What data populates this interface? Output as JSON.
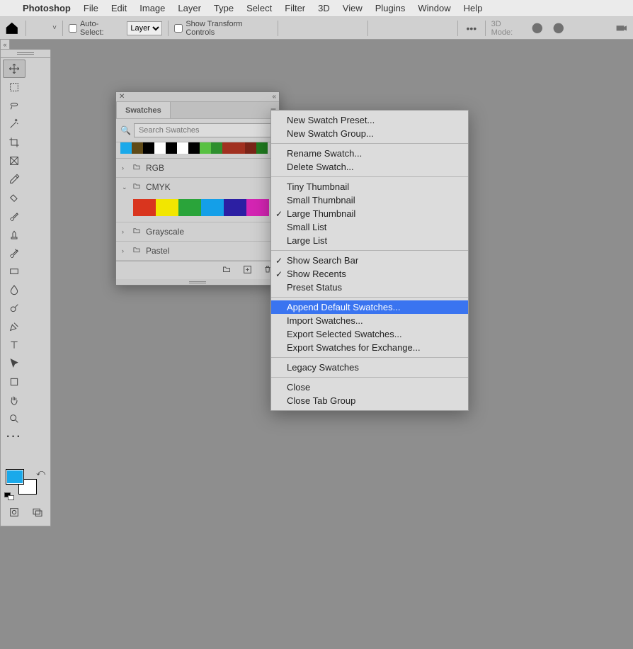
{
  "menubar": {
    "app": "Photoshop",
    "items": [
      "File",
      "Edit",
      "Image",
      "Layer",
      "Type",
      "Select",
      "Filter",
      "3D",
      "View",
      "Plugins",
      "Window",
      "Help"
    ]
  },
  "options_bar": {
    "auto_select_label": "Auto-Select:",
    "layer_dropdown": "Layer",
    "show_transform_label": "Show Transform Controls",
    "mode3d_label": "3D Mode:"
  },
  "toolbox_icons": {
    "move": "move-tool",
    "marquee": "rectangular-marquee-tool",
    "lasso": "lasso-tool",
    "wand": "magic-wand-tool",
    "crop": "crop-tool",
    "frame": "frame-tool",
    "eyedrop": "eyedropper-tool",
    "heal": "healing-brush-tool",
    "brush": "brush-tool",
    "stamp": "clone-stamp-tool",
    "history": "history-brush-tool",
    "grad": "gradient-tool",
    "blur": "blur-tool",
    "dodge": "dodge-tool",
    "pen": "pen-tool",
    "type": "type-tool",
    "path": "path-selection-tool",
    "shape": "shape-tool",
    "hand": "hand-tool",
    "zoom": "zoom-tool",
    "more": "edit-toolbar",
    "quickmask": "quick-mask",
    "screenmode": "screen-mode"
  },
  "swatches_panel": {
    "tab_label": "Swatches",
    "search_placeholder": "Search Swatches",
    "recents": [
      "#1aa9ea",
      "#5f4a17",
      "#000000",
      "#ffffff",
      "#000000",
      "#ffffff",
      "#000000",
      "#58c142",
      "#2e8f2e",
      "#a13020",
      "#a13020",
      "#7a2418",
      "#1f7a1f"
    ],
    "groups": [
      {
        "name": "RGB",
        "open": false
      },
      {
        "name": "CMYK",
        "open": true,
        "swatches": [
          "#d9351e",
          "#f2e600",
          "#2aa43a",
          "#149fe8",
          "#2c1fa3",
          "#d425b3"
        ]
      },
      {
        "name": "Grayscale",
        "open": false
      },
      {
        "name": "Pastel",
        "open": false
      }
    ]
  },
  "context_menu": {
    "sections": [
      [
        {
          "label": "New Swatch Preset...",
          "checked": false
        },
        {
          "label": "New Swatch Group...",
          "checked": false
        }
      ],
      [
        {
          "label": "Rename Swatch...",
          "checked": false
        },
        {
          "label": "Delete Swatch...",
          "checked": false
        }
      ],
      [
        {
          "label": "Tiny Thumbnail",
          "checked": false
        },
        {
          "label": "Small Thumbnail",
          "checked": false
        },
        {
          "label": "Large Thumbnail",
          "checked": true
        },
        {
          "label": "Small List",
          "checked": false
        },
        {
          "label": "Large List",
          "checked": false
        }
      ],
      [
        {
          "label": "Show Search Bar",
          "checked": true
        },
        {
          "label": "Show Recents",
          "checked": true
        },
        {
          "label": "Preset Status",
          "checked": false
        }
      ],
      [
        {
          "label": "Append Default Swatches...",
          "checked": false,
          "hovered": true
        },
        {
          "label": "Import Swatches...",
          "checked": false
        },
        {
          "label": "Export Selected Swatches...",
          "checked": false
        },
        {
          "label": "Export Swatches for Exchange...",
          "checked": false
        }
      ],
      [
        {
          "label": "Legacy Swatches",
          "checked": false
        }
      ],
      [
        {
          "label": "Close",
          "checked": false
        },
        {
          "label": "Close Tab Group",
          "checked": false
        }
      ]
    ]
  }
}
